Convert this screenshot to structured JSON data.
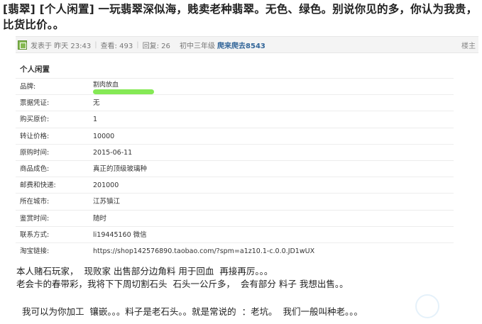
{
  "post": {
    "title": "[翡翠] [个人闲置] 一玩翡翠深似海，贱卖老种翡翠。无色、绿色。别说你见的多，你认为我贵，比货比价。。"
  },
  "meta": {
    "posted": "发表于 昨天 23:43",
    "views": "查看: 493",
    "replies": "回复: 26",
    "level": "初中三年级",
    "author": "爬来爬去8543",
    "floor": "楼主"
  },
  "info_table": {
    "heading": "个人闲置",
    "rows": [
      {
        "label": "品牌:",
        "value": "割肉放血"
      },
      {
        "label": "票据凭证:",
        "value": "无"
      },
      {
        "label": "购买原价:",
        "value": "1"
      },
      {
        "label": "转让价格:",
        "value": "10000"
      },
      {
        "label": "原购时间:",
        "value": "2015-06-11"
      },
      {
        "label": "商品成色:",
        "value": "真正的顶级玻璃种"
      },
      {
        "label": "邮费和快递:",
        "value": "201000"
      },
      {
        "label": "所在城市:",
        "value": "江苏镇江"
      },
      {
        "label": "鉴赏时间:",
        "value": "随时"
      },
      {
        "label": "联系方式:",
        "value": "li19445160 微信"
      },
      {
        "label": "淘宝链接:",
        "value": "https://shop142576890.taobao.com/?spm=a1z10.1-c.0.0.JD1wUX"
      }
    ]
  },
  "body": {
    "line1": "本人赌石玩家，  现败家 出售部分边角料 用于回血  再接再厉。。。",
    "line2": "老会卡的春带彩，我将下下周切割石头  石头一公斤多，  会有部分 料子 我想出售。。",
    "line3": "  我可以为你加工  镶嵌。。。料子是老石头。。就是常说的  ：老坑。  我们一般叫种老。。。"
  },
  "colors": {
    "scribble": "#7ee84c",
    "author": "#336699",
    "meta_bg": "#f4f4f4"
  }
}
